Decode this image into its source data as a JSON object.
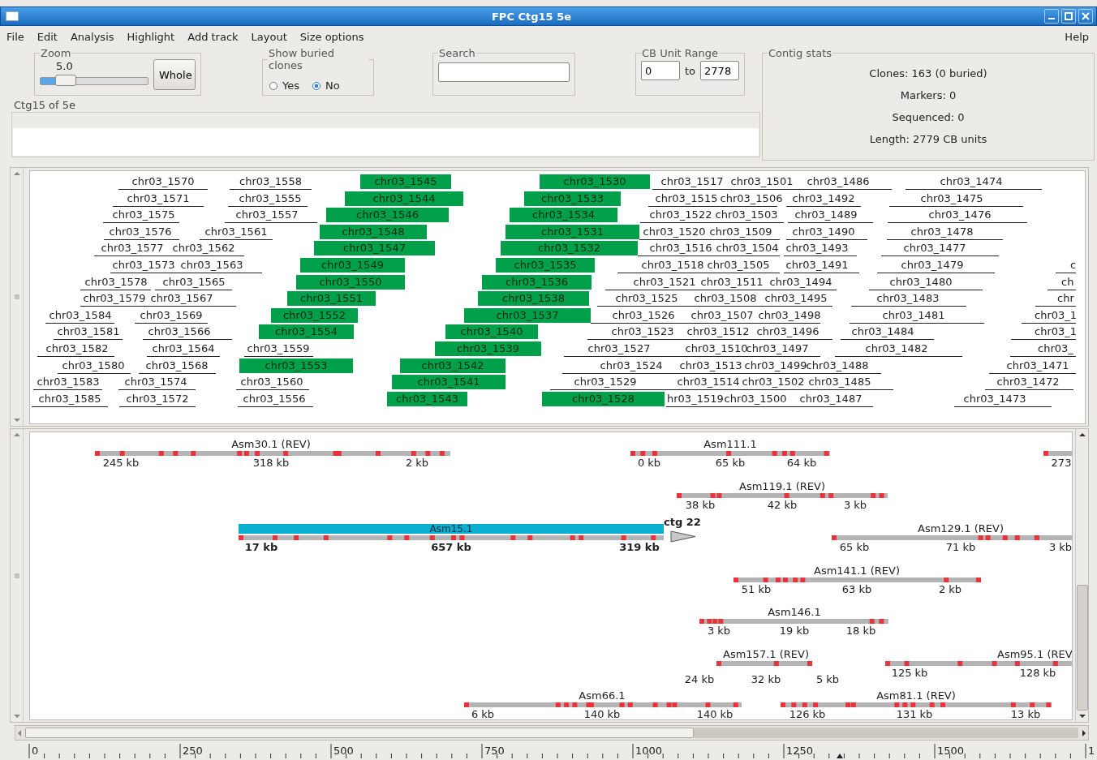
{
  "window": {
    "title": "FPC Ctg15 5e"
  },
  "menu": [
    "File",
    "Edit",
    "Analysis",
    "Highlight",
    "Add track",
    "Layout",
    "Size options"
  ],
  "help_menu": "Help",
  "zoom": {
    "label": "Zoom",
    "value": "5.0",
    "level": 0.2,
    "button": "Whole"
  },
  "buried": {
    "label": "Show buried clones",
    "options": [
      {
        "label": "Yes",
        "selected": false
      },
      {
        "label": "No",
        "selected": true
      }
    ]
  },
  "search": {
    "label": "Search"
  },
  "cb_range": {
    "label": "CB Unit Range",
    "from": "0",
    "to_label": "to",
    "to": "2778"
  },
  "contig_label": "Ctg15 of 5e",
  "contig_stats": {
    "label": "Contig stats",
    "lines": [
      "Clones: 163 (0 buried)",
      "Markers: 0",
      "Sequenced: 0",
      "Length: 2779 CB units"
    ]
  },
  "clone_track": {
    "rows": [
      [
        {
          "label": "chr03_1570",
          "highlighted": false
        },
        {
          "label": "chr03_1558",
          "highlighted": false
        },
        {
          "label": "chr03_1545",
          "highlighted": true
        },
        {
          "label": "chr03_1530",
          "highlighted": true
        },
        {
          "label": "chr03_1517",
          "highlighted": false
        },
        {
          "label": "chr03_1501",
          "highlighted": false
        },
        {
          "label": "chr03_1486",
          "highlighted": false
        },
        {
          "label": "chr03_1474",
          "highlighted": false
        }
      ],
      [
        {
          "label": "chr03_1571",
          "highlighted": false
        },
        {
          "label": "chr03_1555",
          "highlighted": false
        },
        {
          "label": "chr03_1544",
          "highlighted": true
        },
        {
          "label": "chr03_1533",
          "highlighted": true
        },
        {
          "label": "chr03_1515",
          "highlighted": false
        },
        {
          "label": "chr03_1506",
          "highlighted": false
        },
        {
          "label": "chr03_1492",
          "highlighted": false
        },
        {
          "label": "chr03_1475",
          "highlighted": false
        }
      ],
      [
        {
          "label": "chr03_1575",
          "highlighted": false
        },
        {
          "label": "chr03_1557",
          "highlighted": false
        },
        {
          "label": "chr03_1546",
          "highlighted": true
        },
        {
          "label": "chr03_1534",
          "highlighted": true
        },
        {
          "label": "chr03_1522",
          "highlighted": false
        },
        {
          "label": "chr03_1503",
          "highlighted": false
        },
        {
          "label": "chr03_1489",
          "highlighted": false
        },
        {
          "label": "chr03_1476",
          "highlighted": false
        }
      ],
      [
        {
          "label": "chr03_1576",
          "highlighted": false
        },
        {
          "label": "chr03_1561",
          "highlighted": false
        },
        {
          "label": "chr03_1548",
          "highlighted": true
        },
        {
          "label": "chr03_1531",
          "highlighted": true
        },
        {
          "label": "chr03_1520",
          "highlighted": false
        },
        {
          "label": "chr03_1509",
          "highlighted": false
        },
        {
          "label": "chr03_1490",
          "highlighted": false
        },
        {
          "label": "chr03_1478",
          "highlighted": false
        }
      ],
      [
        {
          "label": "chr03_1577",
          "highlighted": false
        },
        {
          "label": "chr03_1562",
          "highlighted": false
        },
        {
          "label": "chr03_1547",
          "highlighted": true
        },
        {
          "label": "chr03_1532",
          "highlighted": true
        },
        {
          "label": "chr03_1516",
          "highlighted": false
        },
        {
          "label": "chr03_1504",
          "highlighted": false
        },
        {
          "label": "chr03_1493",
          "highlighted": false
        },
        {
          "label": "chr03_1477",
          "highlighted": false
        }
      ],
      [
        {
          "label": "chr03_1573",
          "highlighted": false
        },
        {
          "label": "chr03_1563",
          "highlighted": false
        },
        {
          "label": "chr03_1549",
          "highlighted": true
        },
        {
          "label": "chr03_1535",
          "highlighted": true
        },
        {
          "label": "chr03_1518",
          "highlighted": false
        },
        {
          "label": "chr03_1505",
          "highlighted": false
        },
        {
          "label": "chr03_1491",
          "highlighted": false
        },
        {
          "label": "chr03_1479",
          "highlighted": false
        },
        {
          "label": "c",
          "highlighted": false
        }
      ],
      [
        {
          "label": "chr03_1578",
          "highlighted": false
        },
        {
          "label": "chr03_1565",
          "highlighted": false
        },
        {
          "label": "chr03_1550",
          "highlighted": true
        },
        {
          "label": "chr03_1536",
          "highlighted": true
        },
        {
          "label": "chr03_1521",
          "highlighted": false
        },
        {
          "label": "chr03_1511",
          "highlighted": false
        },
        {
          "label": "chr03_1494",
          "highlighted": false
        },
        {
          "label": "chr03_1480",
          "highlighted": false
        },
        {
          "label": "ch",
          "highlighted": false
        }
      ],
      [
        {
          "label": "chr03_1579",
          "highlighted": false
        },
        {
          "label": "chr03_1567",
          "highlighted": false
        },
        {
          "label": "chr03_1551",
          "highlighted": true
        },
        {
          "label": "chr03_1538",
          "highlighted": true
        },
        {
          "label": "chr03_1525",
          "highlighted": false
        },
        {
          "label": "chr03_1508",
          "highlighted": false
        },
        {
          "label": "chr03_1495",
          "highlighted": false
        },
        {
          "label": "chr03_1483",
          "highlighted": false
        },
        {
          "label": "chr",
          "highlighted": false
        }
      ],
      [
        {
          "label": "chr03_1584",
          "highlighted": false
        },
        {
          "label": "chr03_1569",
          "highlighted": false
        },
        {
          "label": "chr03_1552",
          "highlighted": true
        },
        {
          "label": "chr03_1537",
          "highlighted": true
        },
        {
          "label": "chr03_1526",
          "highlighted": false
        },
        {
          "label": "chr03_1507",
          "highlighted": false
        },
        {
          "label": "chr03_1498",
          "highlighted": false
        },
        {
          "label": "chr03_1481",
          "highlighted": false
        },
        {
          "label": "chr03_1",
          "highlighted": false
        }
      ],
      [
        {
          "label": "chr03_1581",
          "highlighted": false
        },
        {
          "label": "chr03_1566",
          "highlighted": false
        },
        {
          "label": "chr03_1554",
          "highlighted": true
        },
        {
          "label": "chr03_1540",
          "highlighted": true
        },
        {
          "label": "chr03_1523",
          "highlighted": false
        },
        {
          "label": "chr03_1512",
          "highlighted": false
        },
        {
          "label": "chr03_1496",
          "highlighted": false
        },
        {
          "label": "chr03_1484",
          "highlighted": false
        },
        {
          "label": "chr03_1",
          "highlighted": false
        }
      ],
      [
        {
          "label": "chr03_1582",
          "highlighted": false
        },
        {
          "label": "chr03_1564",
          "highlighted": false
        },
        {
          "label": "chr03_1559",
          "highlighted": false
        },
        {
          "label": "chr03_1539",
          "highlighted": true
        },
        {
          "label": "chr03_1527",
          "highlighted": false
        },
        {
          "label": "chr03_1510",
          "highlighted": false
        },
        {
          "label": "chr03_1497",
          "highlighted": false
        },
        {
          "label": "chr03_1482",
          "highlighted": false
        },
        {
          "label": "chr03_",
          "highlighted": false
        }
      ],
      [
        {
          "label": "chr03_1580",
          "highlighted": false
        },
        {
          "label": "chr03_1568",
          "highlighted": false
        },
        {
          "label": "chr03_1553",
          "highlighted": true
        },
        {
          "label": "chr03_1542",
          "highlighted": true
        },
        {
          "label": "chr03_1524",
          "highlighted": false
        },
        {
          "label": "chr03_1513",
          "highlighted": false
        },
        {
          "label": "chr03_1499",
          "highlighted": false
        },
        {
          "label": "chr03_1488",
          "highlighted": false
        },
        {
          "label": "chr03_1471",
          "highlighted": false
        }
      ],
      [
        {
          "label": "chr03_1583",
          "highlighted": false
        },
        {
          "label": "chr03_1574",
          "highlighted": false
        },
        {
          "label": "chr03_1560",
          "highlighted": false
        },
        {
          "label": "chr03_1541",
          "highlighted": true
        },
        {
          "label": "chr03_1529",
          "highlighted": false
        },
        {
          "label": "chr03_1514",
          "highlighted": false
        },
        {
          "label": "chr03_1502",
          "highlighted": false
        },
        {
          "label": "chr03_1485",
          "highlighted": false
        },
        {
          "label": "chr03_1472",
          "highlighted": false
        }
      ],
      [
        {
          "label": "chr03_1585",
          "highlighted": false
        },
        {
          "label": "chr03_1572",
          "highlighted": false
        },
        {
          "label": "chr03_1556",
          "highlighted": false
        },
        {
          "label": "chr03_1543",
          "highlighted": true
        },
        {
          "label": "chr03_1528",
          "highlighted": true
        },
        {
          "label": "hr03_1519",
          "highlighted": false
        },
        {
          "label": "chr03_1500",
          "highlighted": false
        },
        {
          "label": "chr03_1487",
          "highlighted": false
        },
        {
          "label": "chr03_1473",
          "highlighted": false
        }
      ]
    ]
  },
  "sequence_track": {
    "assemblies": [
      {
        "name": "Asm30.1 (REV)",
        "highlighted": false,
        "kb": [
          "245 kb",
          "318 kb",
          "2 kb"
        ]
      },
      {
        "name": "Asm111.1",
        "highlighted": false,
        "kb": [
          "0 kb",
          "65 kb",
          "64 kb"
        ]
      },
      {
        "highlighted": false,
        "kb": [
          "273"
        ]
      },
      {
        "name": "Asm119.1 (REV)",
        "highlighted": false,
        "kb": [
          "38 kb",
          "42 kb",
          "3 kb"
        ]
      },
      {
        "name": "Asm15.1",
        "highlighted": true,
        "kb": [
          "17 kb",
          "657 kb",
          "319 kb"
        ]
      },
      {
        "name": "Asm129.1 (REV)",
        "highlighted": false,
        "kb": [
          "65 kb",
          "71 kb",
          "3 kb"
        ]
      },
      {
        "name": "Asm141.1 (REV)",
        "highlighted": false,
        "kb": [
          "51 kb",
          "63 kb",
          "2 kb"
        ]
      },
      {
        "name": "Asm146.1",
        "highlighted": false,
        "kb": [
          "3 kb",
          "19 kb",
          "18 kb"
        ]
      },
      {
        "name": "Asm157.1 (REV)",
        "highlighted": false,
        "kb": [
          "24 kb",
          "32 kb",
          "5 kb"
        ]
      },
      {
        "name": "Asm95.1 (REV",
        "highlighted": false,
        "kb": [
          "125 kb",
          "128 kb"
        ]
      },
      {
        "name": "Asm66.1",
        "highlighted": false,
        "kb": [
          "6 kb",
          "140 kb",
          "140 kb"
        ]
      },
      {
        "name": "Asm81.1 (REV)",
        "highlighted": false,
        "kb": [
          "126 kb",
          "131 kb",
          "13 kb"
        ]
      }
    ],
    "contig_link": "ctg 22"
  },
  "ruler": {
    "labels": [
      "0",
      "250",
      "500",
      "750",
      "1000",
      "1250",
      "1500",
      "1"
    ]
  }
}
